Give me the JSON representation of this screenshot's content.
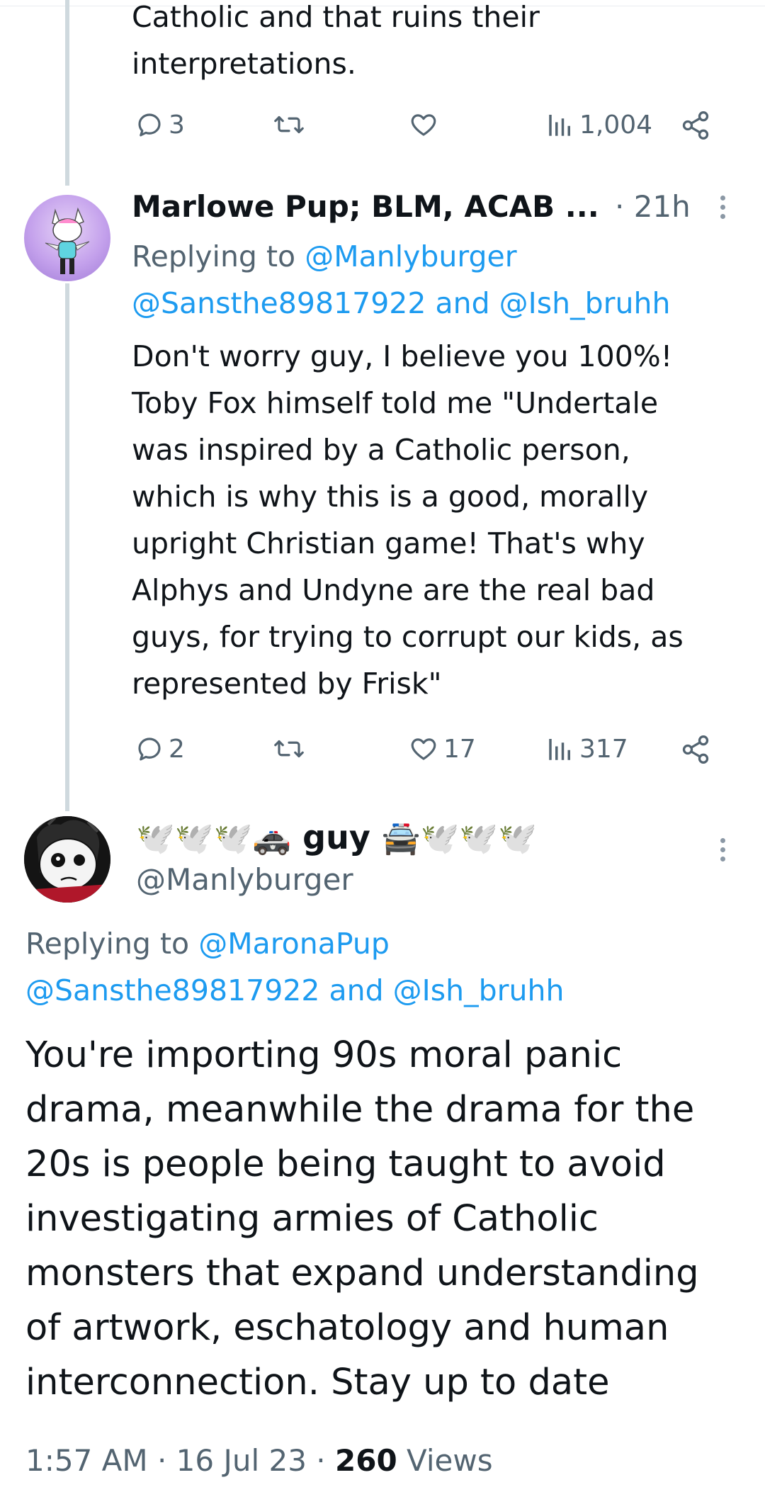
{
  "prev_tweet": {
    "body_lines": [
      "Catholic and that ruins their",
      "interpretations."
    ],
    "actions": {
      "replies": "3",
      "retweets": "",
      "likes": "",
      "views": "1,004"
    }
  },
  "reply_tweet": {
    "name": "Marlowe Pup; BLM, ACAB ...",
    "time": "· 21h",
    "replying_prefix": "Replying to",
    "replying_user": "@Manlyburger",
    "replying_line2": "@Sansthe89817922 and @Ish_bruhh",
    "body_lines": [
      "Don't worry guy, I believe you 100%!",
      "Toby Fox himself told me \"Undertale",
      "was inspired by a Catholic person,",
      "which is why this is a good, morally",
      "upright Christian game! That's why",
      "Alphys and Undyne are the real bad",
      "guys, for trying to corrupt our kids, as",
      "represented by Frisk\""
    ],
    "actions": {
      "replies": "2",
      "retweets": "",
      "likes": "17",
      "views": "317"
    }
  },
  "main_tweet": {
    "name_emoji_left": "🕊️🕊️🕊️🚓",
    "name_text": "guy",
    "name_emoji_right": "🚔🕊️🕊️🕊️",
    "handle": "@Manlyburger",
    "replying_prefix": "Replying to",
    "replying_user": "@MaronaPup",
    "replying_line2": "@Sansthe89817922 and @Ish_bruhh",
    "body_lines": [
      "You're importing 90s moral panic",
      "drama, meanwhile the drama for the",
      "20s is people being taught to avoid",
      "investigating armies of Catholic",
      "monsters that expand understanding",
      "of artwork, eschatology and human",
      "interconnection. Stay up to date"
    ],
    "meta_time": "1:57 AM · 16 Jul 23 · ",
    "meta_views": "260",
    "meta_views_label": " Views"
  },
  "colors": {
    "text": "#0f1419",
    "muted": "#536471",
    "link": "#1d9bf0",
    "thread_line": "#cfd9de"
  },
  "icons": [
    "reply-icon",
    "retweet-icon",
    "like-icon",
    "views-icon",
    "share-icon",
    "more-icon"
  ]
}
